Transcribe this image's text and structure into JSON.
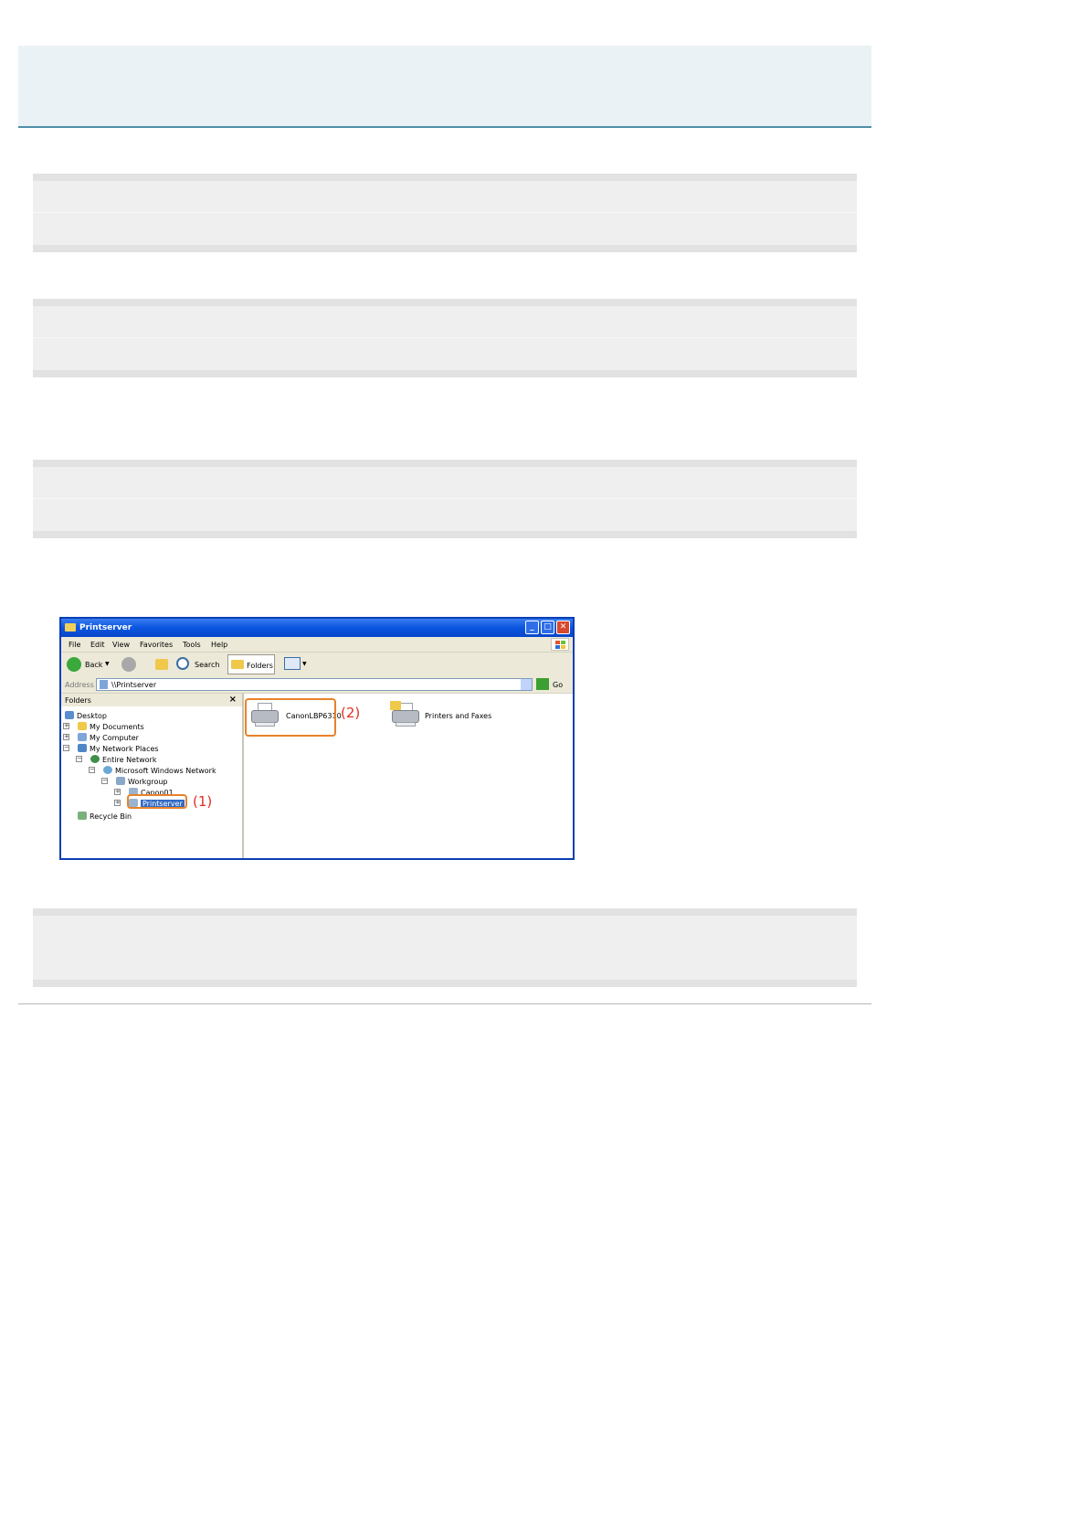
{
  "window": {
    "title": "Printserver",
    "menu": [
      "File",
      "Edit",
      "View",
      "Favorites",
      "Tools",
      "Help"
    ],
    "toolbar": {
      "back": "Back",
      "search": "Search",
      "folders": "Folders"
    },
    "address": {
      "label": "Address",
      "value": "\\\\Printserver",
      "go": "Go"
    },
    "folders_pane": {
      "title": "Folders",
      "items": [
        "Desktop",
        "My Documents",
        "My Computer",
        "My Network Places",
        "Entire Network",
        "Microsoft Windows Network",
        "Workgroup",
        "Canon01",
        "Printserver",
        "Recycle Bin"
      ]
    },
    "content_items": [
      "CanonLBP6310",
      "Printers and Faxes"
    ]
  },
  "callouts": [
    "(1)",
    "(2)"
  ],
  "colors": {
    "header_band": "#eaf2f5",
    "header_rule": "#4f8fa8",
    "note_box": "#efefef",
    "callout_border": "#e8822a",
    "callout_text": "#e03020",
    "xp_title_blue": "#0a55e0"
  }
}
